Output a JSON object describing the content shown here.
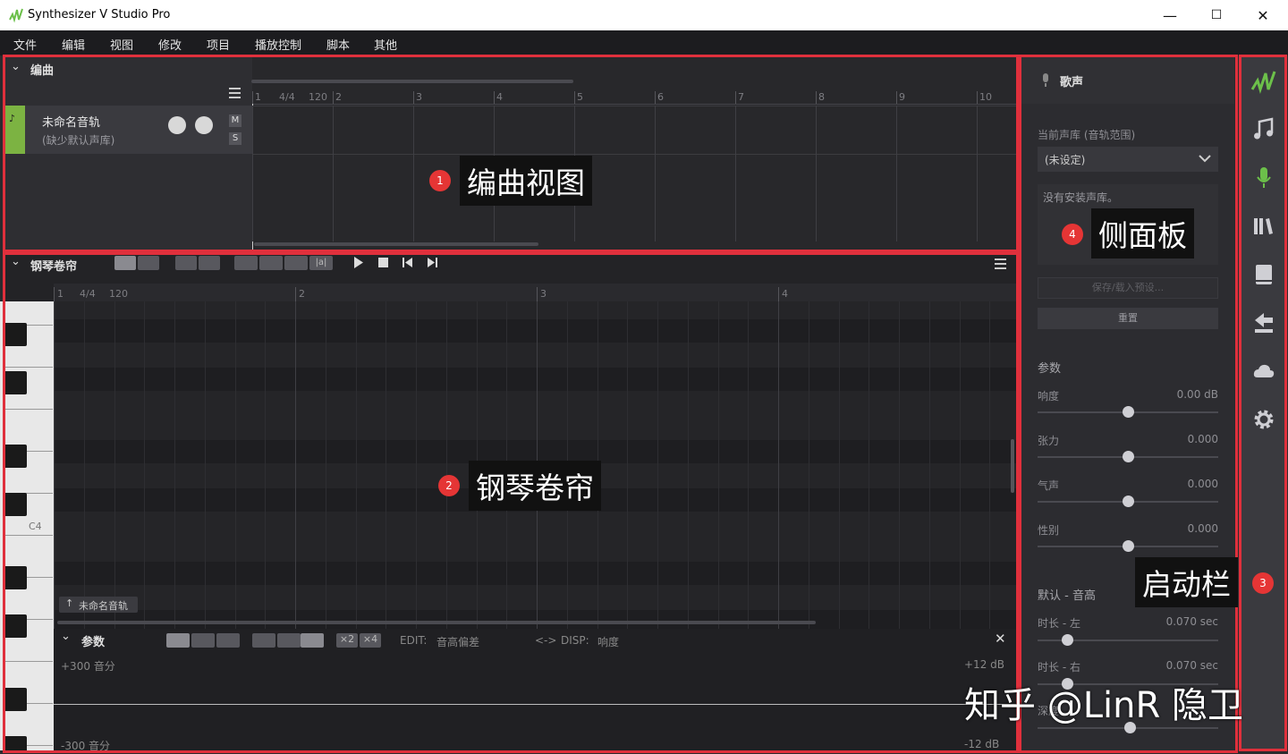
{
  "window": {
    "title": "Synthesizer V Studio Pro",
    "minimize": "—",
    "maximize": "☐",
    "close": "✕"
  },
  "menu": [
    "文件",
    "编辑",
    "视图",
    "修改",
    "项目",
    "播放控制",
    "脚本",
    "其他"
  ],
  "arrangement": {
    "header": "编曲",
    "ruler": {
      "time_sig": "4/4",
      "tempo": "120",
      "measures": [
        "1",
        "2",
        "3",
        "4",
        "5",
        "6",
        "7",
        "8",
        "9",
        "10"
      ]
    },
    "track": {
      "name": "未命名音轨",
      "subtitle": "(缺少默认声库)",
      "mute": "M",
      "solo": "S"
    }
  },
  "piano_roll": {
    "header": "钢琴卷帘",
    "ruler": {
      "time_sig": "4/4",
      "tempo": "120",
      "measures": [
        "1",
        "2",
        "3",
        "4"
      ]
    },
    "c4_label": "C4",
    "track_chip": "未命名音轨",
    "tool_text": "|a|"
  },
  "params": {
    "header": "参数",
    "multiplier_2": "×2",
    "multiplier_4": "×4",
    "edit_label": "EDIT:",
    "edit_value": "音高偏差",
    "swap": "<->",
    "disp_label": "DISP:",
    "disp_value": "响度",
    "top_left": "+300 音分",
    "bottom_left": "-300 音分",
    "top_right": "+12 dB",
    "bottom_right": "-12 dB",
    "close": "✕"
  },
  "side": {
    "header": "歌声",
    "voicebank_label": "当前声库 (音轨范围)",
    "voicebank_value": "(未设定)",
    "no_voicebank": "没有安装声库。",
    "save_load": "保存/载入预设...",
    "reset": "重置",
    "params_title": "参数",
    "params": [
      {
        "label": "响度",
        "value": "0.00 dB"
      },
      {
        "label": "张力",
        "value": "0.000"
      },
      {
        "label": "气声",
        "value": "0.000"
      },
      {
        "label": "性别",
        "value": "0.000"
      }
    ],
    "pitch_title": "默认 - 音高",
    "pitch_params": [
      {
        "label": "时长 - 左",
        "value": "0.070 sec"
      },
      {
        "label": "时长 - 右",
        "value": "0.070 sec"
      },
      {
        "label": "深度",
        "value": ""
      }
    ]
  },
  "launcher": {
    "icons": [
      "synthv-logo-icon",
      "music-note-icon",
      "microphone-icon",
      "library-icon",
      "book-icon",
      "render-icon",
      "cloud-icon",
      "settings-gear-icon"
    ],
    "active_color": "#6cc04a"
  },
  "annotations": [
    {
      "num": "1",
      "text": "编曲视图"
    },
    {
      "num": "2",
      "text": "钢琴卷帘"
    },
    {
      "num": "3",
      "text": "启动栏"
    },
    {
      "num": "4",
      "text": "侧面板"
    }
  ],
  "watermark": "知乎 @LinR 隐卫"
}
